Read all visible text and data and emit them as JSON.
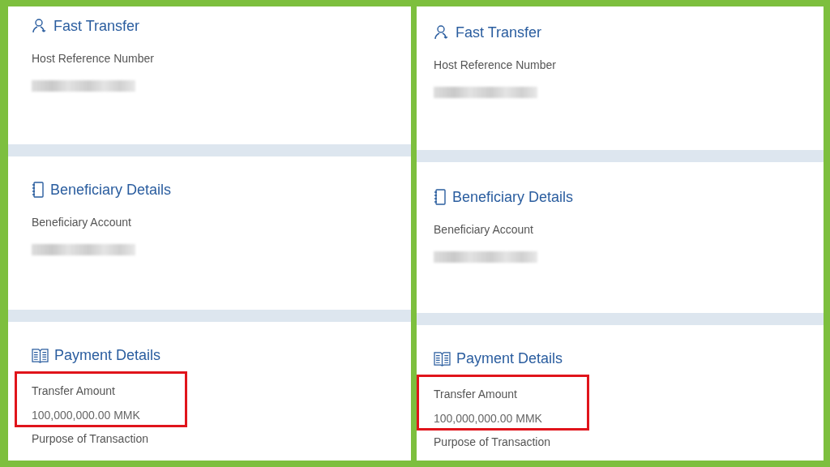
{
  "panels": [
    {
      "sections": [
        {
          "title": "Fast Transfer",
          "fields": [
            {
              "label": "Host Reference Number",
              "value_hidden": true,
              "highlighted": false
            }
          ]
        },
        {
          "title": "Beneficiary Details",
          "fields": [
            {
              "label": "Beneficiary Account",
              "value_hidden": true,
              "highlighted": false
            }
          ]
        },
        {
          "title": "Payment Details",
          "fields": [
            {
              "label": "Transfer Amount",
              "value": "100,000,000.00 MMK",
              "highlighted": true
            },
            {
              "label": "Purpose of Transaction",
              "highlighted": false
            }
          ]
        }
      ]
    },
    {
      "sections": [
        {
          "title": "Fast Transfer",
          "fields": [
            {
              "label": "Host Reference Number",
              "value_hidden": true,
              "highlighted": false
            }
          ]
        },
        {
          "title": "Beneficiary Details",
          "fields": [
            {
              "label": "Beneficiary Account",
              "value_hidden": true,
              "highlighted": false
            }
          ]
        },
        {
          "title": "Payment Details",
          "fields": [
            {
              "label": "Transfer Amount",
              "value": "100,000,000.00 MMK",
              "highlighted": true
            },
            {
              "label": "Purpose of Transaction",
              "highlighted": false
            }
          ]
        }
      ]
    }
  ]
}
